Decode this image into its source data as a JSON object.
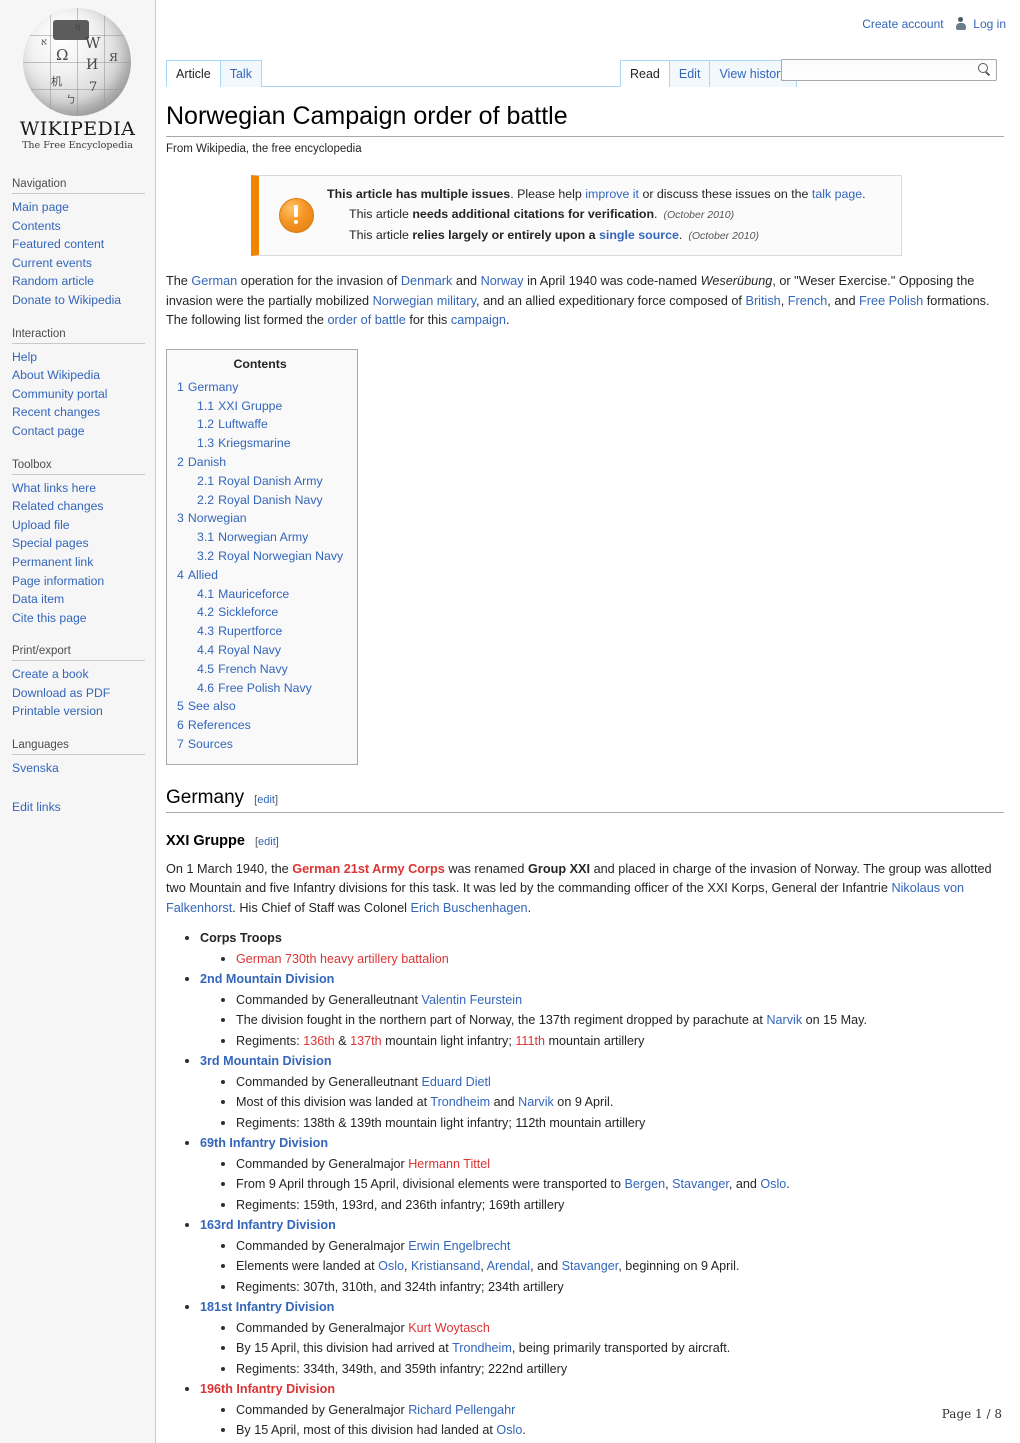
{
  "personal": {
    "create_account": "Create account",
    "log_in": "Log in"
  },
  "tabs": {
    "namespaces": [
      {
        "label": "Article",
        "selected": true
      },
      {
        "label": "Talk",
        "selected": false
      }
    ],
    "views": [
      {
        "label": "Read",
        "selected": true
      },
      {
        "label": "Edit",
        "selected": false
      },
      {
        "label": "View history",
        "selected": false
      }
    ]
  },
  "search": {
    "value": "",
    "placeholder": ""
  },
  "logo": {
    "wordmark": "WIKIPEDIA",
    "tagline": "The Free Encyclopedia",
    "glyphs": [
      "Ω",
      "W",
      "И",
      "7",
      "机",
      "य",
      "א",
      "Я"
    ]
  },
  "sidebar": {
    "portals": [
      {
        "heading": "Navigation",
        "items": [
          "Main page",
          "Contents",
          "Featured content",
          "Current events",
          "Random article",
          "Donate to Wikipedia"
        ]
      },
      {
        "heading": "Interaction",
        "items": [
          "Help",
          "About Wikipedia",
          "Community portal",
          "Recent changes",
          "Contact page"
        ]
      },
      {
        "heading": "Toolbox",
        "items": [
          "What links here",
          "Related changes",
          "Upload file",
          "Special pages",
          "Permanent link",
          "Page information",
          "Data item",
          "Cite this page"
        ]
      },
      {
        "heading": "Print/export",
        "items": [
          "Create a book",
          "Download as PDF",
          "Printable version"
        ]
      },
      {
        "heading": "Languages",
        "items": [
          "Svenska"
        ]
      }
    ],
    "edit_links": "Edit links"
  },
  "header": {
    "title": "Norwegian Campaign order of battle",
    "subtitle": "From Wikipedia, the free encyclopedia"
  },
  "ambox": {
    "line1_bold": "This article has multiple issues",
    "line1_a": ". Please help ",
    "line1_link1": "improve it",
    "line1_b": " or discuss these issues on the ",
    "line1_link2": "talk page",
    "line1_c": ".",
    "issue2_a": "This article ",
    "issue2_bold": "needs additional citations for verification",
    "issue2_b": ".",
    "issue2_date": "(October 2010)",
    "issue3_a": "This article ",
    "issue3_bold1": "relies largely or entirely upon a ",
    "issue3_link": "single source",
    "issue3_b": ".",
    "issue3_date": "(October 2010)"
  },
  "intro": {
    "t1": "The ",
    "l1": "German",
    "t2": " operation for the invasion of ",
    "l2": "Denmark",
    "t3": " and ",
    "l3": "Norway",
    "t4": " in April 1940 was code-named ",
    "i1": "Weserübung",
    "t5": ", or \"Weser Exercise.\" Opposing the invasion were the partially mobilized ",
    "l4": "Norwegian military",
    "t6": ", and an allied expeditionary force composed of ",
    "l5": "British",
    "t7": ", ",
    "l6": "French",
    "t8": ", and ",
    "l7": "Free Polish",
    "t9": " formations. The following list formed the ",
    "l8": "order of battle",
    "t10": " for this ",
    "l9": "campaign",
    "t11": "."
  },
  "toc": {
    "title": "Contents",
    "entries": [
      {
        "num": "1",
        "label": "Germany",
        "level": 1
      },
      {
        "num": "1.1",
        "label": "XXI Gruppe",
        "level": 2
      },
      {
        "num": "1.2",
        "label": "Luftwaffe",
        "level": 2
      },
      {
        "num": "1.3",
        "label": "Kriegsmarine",
        "level": 2
      },
      {
        "num": "2",
        "label": "Danish",
        "level": 1
      },
      {
        "num": "2.1",
        "label": "Royal Danish Army",
        "level": 2
      },
      {
        "num": "2.2",
        "label": "Royal Danish Navy",
        "level": 2
      },
      {
        "num": "3",
        "label": "Norwegian",
        "level": 1
      },
      {
        "num": "3.1",
        "label": "Norwegian Army",
        "level": 2
      },
      {
        "num": "3.2",
        "label": "Royal Norwegian Navy",
        "level": 2
      },
      {
        "num": "4",
        "label": "Allied",
        "level": 1
      },
      {
        "num": "4.1",
        "label": "Mauriceforce",
        "level": 2
      },
      {
        "num": "4.2",
        "label": "Sickleforce",
        "level": 2
      },
      {
        "num": "4.3",
        "label": "Rupertforce",
        "level": 2
      },
      {
        "num": "4.4",
        "label": "Royal Navy",
        "level": 2
      },
      {
        "num": "4.5",
        "label": "French Navy",
        "level": 2
      },
      {
        "num": "4.6",
        "label": "Free Polish Navy",
        "level": 2
      },
      {
        "num": "5",
        "label": "See also",
        "level": 1
      },
      {
        "num": "6",
        "label": "References",
        "level": 1
      },
      {
        "num": "7",
        "label": "Sources",
        "level": 1
      }
    ]
  },
  "sections": {
    "germany": "Germany",
    "xxi_gruppe": "XXI Gruppe",
    "edit_label": "edit",
    "edit_open": "[",
    "edit_close": "]"
  },
  "xxi_paragraph": {
    "p1": "On 1 March 1940, the ",
    "redlink": "German 21st Army Corps",
    "p2": " was renamed ",
    "bold": "Group XXI",
    "p3": " and placed in charge of the invasion of Norway. The group was allotted two Mountain and five Infantry divisions for this task. It was led by the commanding officer of the XXI Korps, General der Infantrie ",
    "l1": "Nikolaus von Falkenhorst",
    "p4": ". His Chief of Staff was Colonel ",
    "l2": "Erich Buschenhagen",
    "p5": "."
  },
  "units": [
    {
      "title": "Corps Troops",
      "title_style": "black-bold",
      "children": [
        {
          "style": "red",
          "text": "German 730th heavy artillery battalion"
        }
      ]
    },
    {
      "title": "2nd Mountain Division",
      "title_style": "blue-bold",
      "children": [
        {
          "style": "mixed",
          "pre": "Commanded by Generalleutnant ",
          "link": "Valentin Feurstein",
          "post": ""
        },
        {
          "style": "mixed",
          "pre": "The division fought in the northern part of Norway, the 137th regiment dropped by parachute at ",
          "link": "Narvik",
          "post": " on 15 May."
        },
        {
          "style": "regiments",
          "pre": "Regiments: ",
          "red1": "136th",
          "mid1": " & ",
          "red2": "137th",
          "mid2": " mountain light infantry; ",
          "red3": "111th",
          "post": " mountain artillery"
        }
      ]
    },
    {
      "title": "3rd Mountain Division",
      "title_style": "blue-bold",
      "children": [
        {
          "style": "mixed",
          "pre": "Commanded by Generalleutnant ",
          "link": "Eduard Dietl",
          "post": ""
        },
        {
          "style": "mixed2",
          "pre": "Most of this division was landed at ",
          "link": "Trondheim",
          "mid": " and ",
          "link2": "Narvik",
          "post": " on 9 April."
        },
        {
          "style": "plain",
          "text": "Regiments: 138th & 139th mountain light infantry; 112th mountain artillery"
        }
      ]
    },
    {
      "title": "69th Infantry Division",
      "title_style": "blue-bold",
      "children": [
        {
          "style": "mixed-red",
          "pre": "Commanded by Generalmajor ",
          "link": "Hermann Tittel",
          "post": ""
        },
        {
          "style": "mixed3",
          "pre": "From 9 April through 15 April, divisional elements were transported to ",
          "link": "Bergen",
          "mid": ", ",
          "link2": "Stavanger",
          "mid2": ", and ",
          "link3": "Oslo",
          "post": "."
        },
        {
          "style": "plain",
          "text": "Regiments: 159th, 193rd, and 236th infantry; 169th artillery"
        }
      ]
    },
    {
      "title": "163rd Infantry Division",
      "title_style": "blue-bold",
      "children": [
        {
          "style": "mixed",
          "pre": "Commanded by Generalmajor ",
          "link": "Erwin Engelbrecht",
          "post": ""
        },
        {
          "style": "mixed4",
          "pre": "Elements were landed at ",
          "link": "Oslo",
          "mid": ", ",
          "link2": "Kristiansand",
          "mid2": ", ",
          "link3": "Arendal",
          "mid3": ", and ",
          "link4": "Stavanger",
          "post": ", beginning on 9 April."
        },
        {
          "style": "plain",
          "text": "Regiments: 307th, 310th, and 324th infantry; 234th artillery"
        }
      ]
    },
    {
      "title": "181st Infantry Division",
      "title_style": "blue-bold",
      "children": [
        {
          "style": "mixed-red",
          "pre": "Commanded by Generalmajor ",
          "link": "Kurt Woytasch",
          "post": ""
        },
        {
          "style": "mixed",
          "pre": "By 15 April, this division had arrived at ",
          "link": "Trondheim",
          "post": ", being primarily transported by aircraft."
        },
        {
          "style": "plain",
          "text": "Regiments: 334th, 349th, and 359th infantry; 222nd artillery"
        }
      ]
    },
    {
      "title": "196th Infantry Division",
      "title_style": "red-bold",
      "children": [
        {
          "style": "mixed",
          "pre": "Commanded by Generalmajor ",
          "link": "Richard Pellengahr",
          "post": ""
        },
        {
          "style": "mixed",
          "pre": "By 15 April, most of this division had landed at ",
          "link": "Oslo",
          "post": "."
        }
      ]
    }
  ],
  "footer": {
    "page_indicator": "Page 1 / 8"
  },
  "colors": {
    "link": "#3366bb",
    "redlink": "#dd3333",
    "ambox_accent": "#f28500",
    "tab_border": "#a7d7f9",
    "sidebar_bg": "#f6f6f6"
  }
}
